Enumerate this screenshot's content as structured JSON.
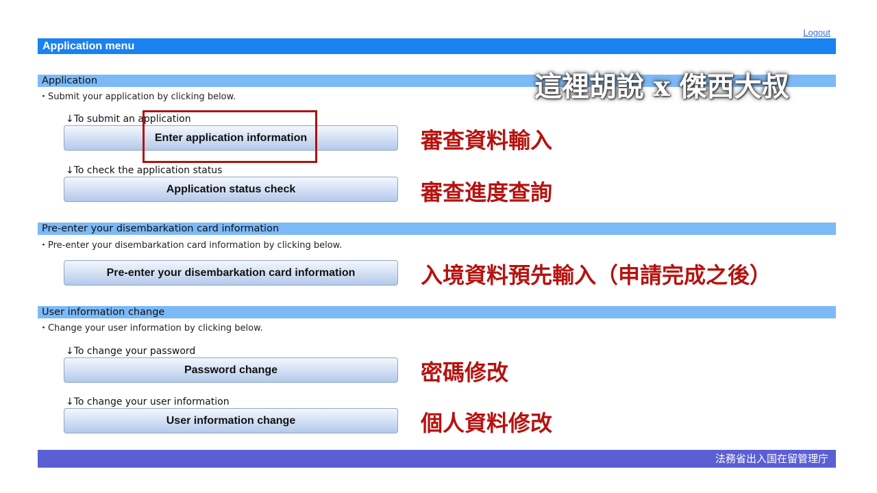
{
  "header": {
    "logout_label": "Logout",
    "menu_title": "Application menu"
  },
  "watermark": "這裡胡說 x 傑西大叔",
  "sections": [
    {
      "title": "Application",
      "description": "・Submit your application by clicking below.",
      "actions": [
        {
          "label": "↓To submit an application",
          "button": "Enter application information",
          "annotation": "審查資料輸入"
        },
        {
          "label": "↓To check the application status",
          "button": "Application status check",
          "annotation": "審查進度查詢"
        }
      ]
    },
    {
      "title": "Pre-enter your disembarkation card information",
      "description": "・Pre-enter your disembarkation card information by clicking below.",
      "actions": [
        {
          "label": "",
          "button": "Pre-enter your disembarkation card information",
          "annotation": "入境資料預先輸入（申請完成之後）"
        }
      ]
    },
    {
      "title": "User information change",
      "description": "・Change your user information by clicking below.",
      "actions": [
        {
          "label": "↓To change your password",
          "button": "Password change",
          "annotation": "密碼修改"
        },
        {
          "label": "↓To change your user information",
          "button": "User information change",
          "annotation": "個人資料修改"
        }
      ]
    }
  ],
  "footer": "法務省出入国在留管理庁",
  "colors": {
    "menu_bar": "#1a82f0",
    "section_bar": "#7cb9f7",
    "footer": "#5a5fd4",
    "annotation": "#b5130f",
    "highlight": "#b10f10"
  }
}
